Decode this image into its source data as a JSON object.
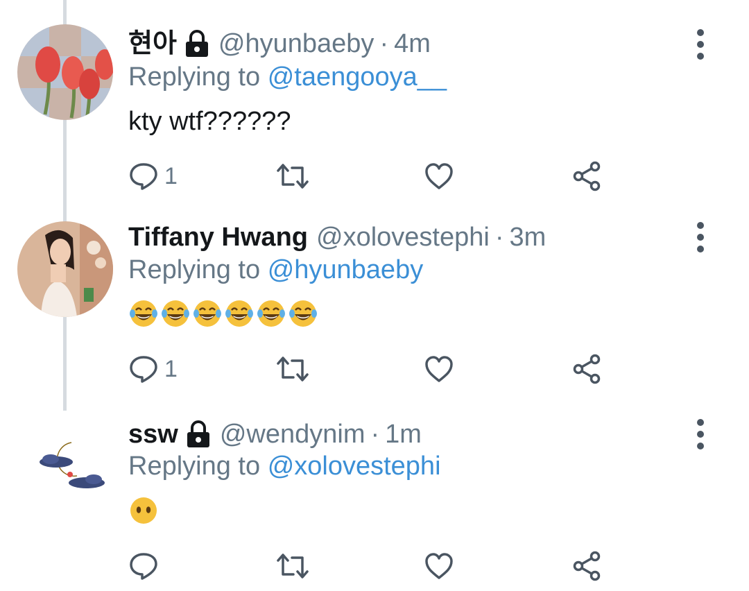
{
  "tweets": [
    {
      "name": "현아",
      "handle": "@hyunbaeby",
      "separator": "·",
      "time": "4m",
      "locked": true,
      "replying_prefix": "Replying to",
      "replying_to": "@taengooya__",
      "text": "kty wtf??????",
      "reply_count": "1",
      "avatar": "tulips-avatar"
    },
    {
      "name": "Tiffany Hwang",
      "handle": "@xolovestephi",
      "separator": "·",
      "time": "3m",
      "locked": false,
      "replying_prefix": "Replying to",
      "replying_to": "@hyunbaeby",
      "emojis": [
        "face-with-tears-of-joy",
        "face-with-tears-of-joy",
        "face-with-tears-of-joy",
        "face-with-tears-of-joy",
        "face-with-tears-of-joy",
        "face-with-tears-of-joy"
      ],
      "reply_count": "1",
      "avatar": "woman-portrait-avatar"
    },
    {
      "name": "ssw",
      "handle": "@wendynim",
      "separator": "·",
      "time": "1m",
      "locked": true,
      "replying_prefix": "Replying to",
      "replying_to": "@xolovestephi",
      "emojis": [
        "face-without-mouth"
      ],
      "reply_count": "",
      "avatar": "moon-clouds-avatar"
    }
  ],
  "icons": {
    "more": "more-vertical-icon",
    "reply": "reply-bubble-icon",
    "retweet": "retweet-icon",
    "like": "heart-icon",
    "share": "share-icon",
    "lock": "lock-icon"
  },
  "colors": {
    "mention": "#3b8fd6",
    "secondary_text": "#657786",
    "thread_line": "#d6dbe0",
    "icon": "#4a5561"
  }
}
